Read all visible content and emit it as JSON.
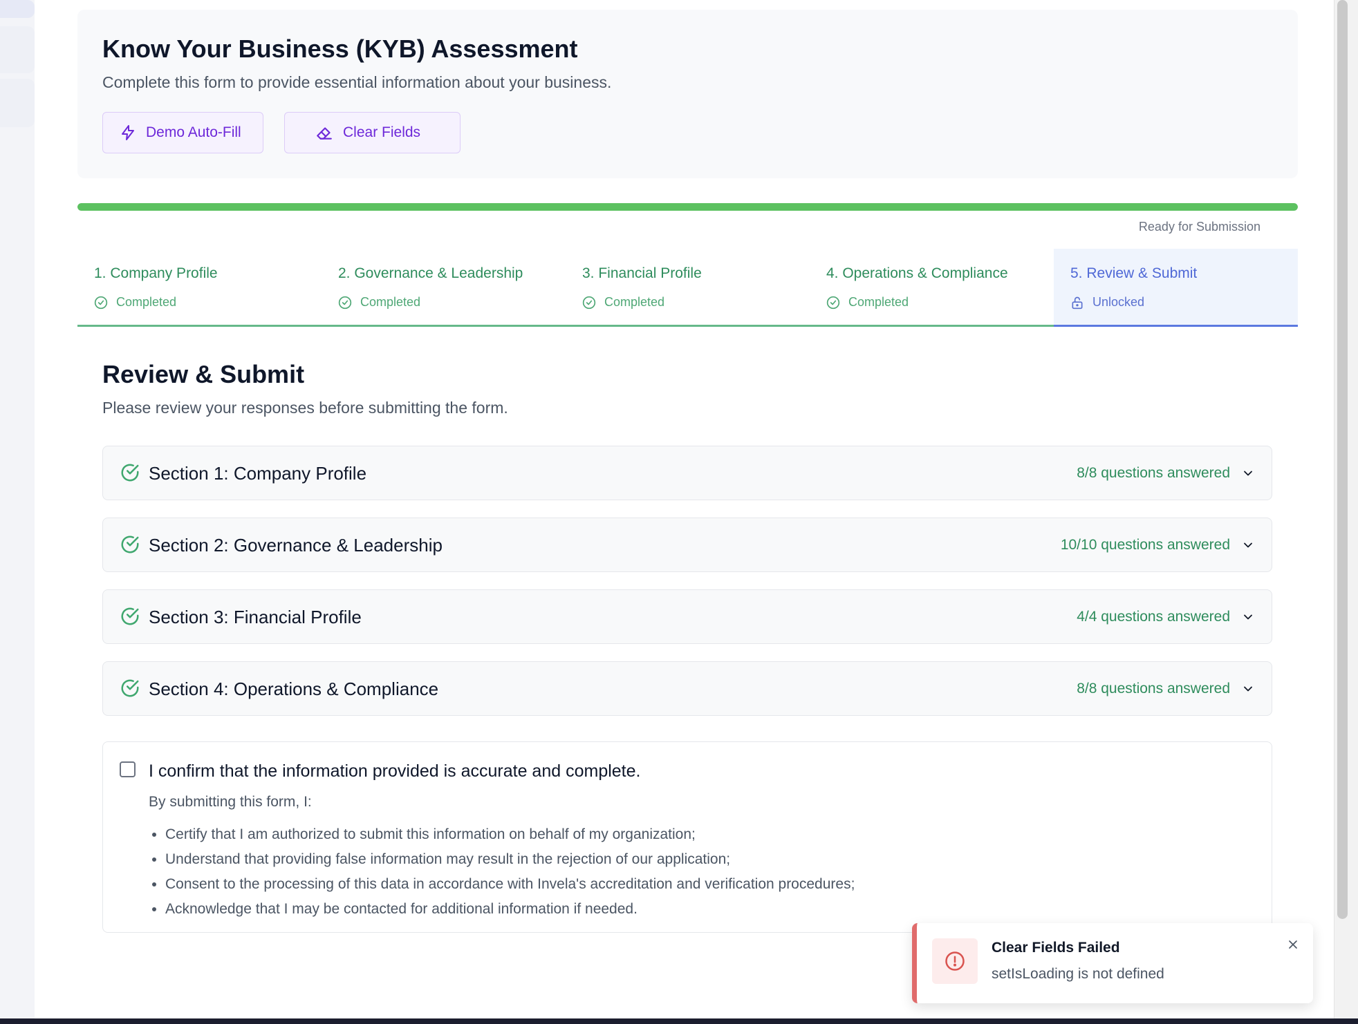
{
  "header": {
    "title": "Know Your Business (KYB) Assessment",
    "subtitle": "Complete this form to provide essential information about your business.",
    "autofill_label": "Demo Auto-Fill",
    "clear_label": "Clear Fields"
  },
  "progress": {
    "fraction": 1.0,
    "status_text": "Ready for Submission",
    "color": "#5cc160"
  },
  "steps": [
    {
      "label": "1. Company Profile",
      "status": "Completed",
      "state": "completed"
    },
    {
      "label": "2. Governance & Leadership",
      "status": "Completed",
      "state": "completed"
    },
    {
      "label": "3. Financial Profile",
      "status": "Completed",
      "state": "completed"
    },
    {
      "label": "4. Operations & Compliance",
      "status": "Completed",
      "state": "completed"
    },
    {
      "label": "5. Review & Submit",
      "status": "Unlocked",
      "state": "active"
    }
  ],
  "review": {
    "title": "Review & Submit",
    "subtitle": "Please review your responses before submitting the form.",
    "sections": [
      {
        "name": "Section 1: Company Profile",
        "answered": "8/8 questions answered"
      },
      {
        "name": "Section 2: Governance & Leadership",
        "answered": "10/10 questions answered"
      },
      {
        "name": "Section 3: Financial Profile",
        "answered": "4/4 questions answered"
      },
      {
        "name": "Section 4: Operations & Compliance",
        "answered": "8/8 questions answered"
      }
    ]
  },
  "confirm": {
    "checked": false,
    "label": "I confirm that the information provided is accurate and complete.",
    "intro": "By submitting this form, I:",
    "items": [
      "Certify that I am authorized to submit this information on behalf of my organization;",
      "Understand that providing false information may result in the rejection of our application;",
      "Consent to the processing of this data in accordance with Invela's accreditation and verification procedures;",
      "Acknowledge that I may be contacted for additional information if needed."
    ]
  },
  "toast": {
    "title": "Clear Fields Failed",
    "message": "setIsLoading is not defined",
    "icon": "alert-circle-icon",
    "close_icon": "close-icon",
    "accent": "#e06b6b"
  },
  "colors": {
    "accent_purple": "#6d28d9",
    "success_green": "#2e8c5c",
    "active_blue": "#4f68d6",
    "error_red": "#e06b6b"
  }
}
